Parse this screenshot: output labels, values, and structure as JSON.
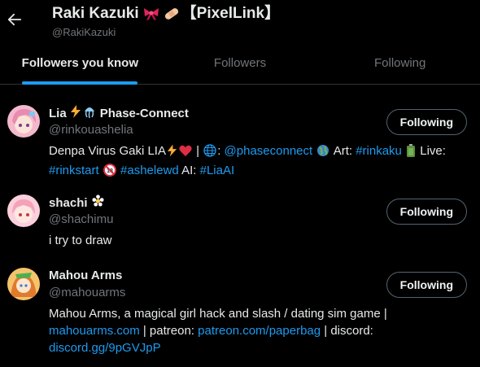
{
  "header": {
    "name": "Raki Kazuki",
    "name_suffix": "【PixelLink】",
    "handle": "@RakiKazuki"
  },
  "tabs": [
    {
      "label": "Followers you know",
      "active": true
    },
    {
      "label": "Followers",
      "active": false
    },
    {
      "label": "Following",
      "active": false
    }
  ],
  "colors": {
    "accent": "#1d9bf0",
    "muted": "#71767b",
    "text": "#e7e9ea",
    "background": "#000000"
  },
  "users": [
    {
      "name": "Lia",
      "name_suffix": "Phase-Connect",
      "handle": "@rinkouashelia",
      "button": "Following",
      "bio": {
        "t1": "Denpa Virus Gaki LIA",
        "t2": " | ",
        "t3": ": ",
        "l1": "@phaseconnect",
        "t4": " Art: ",
        "l2": "#rinkaku",
        "t5": " Live:",
        "l3": "#rinkstart",
        "t6": " ",
        "l4": "#ashelewd",
        "t7": " AI: ",
        "l5": "#LiaAI"
      }
    },
    {
      "name": "shachi",
      "handle": "@shachimu",
      "button": "Following",
      "bio": {
        "t1": "i try to draw"
      }
    },
    {
      "name": "Mahou Arms",
      "handle": "@mahouarms",
      "button": "Following",
      "bio": {
        "t1": "Mahou Arms, a magical girl hack and slash / dating sim game |",
        "l1": "mahouarms.com",
        "t2": " | patreon: ",
        "l2": "patreon.com/paperbag",
        "t3": " | discord:",
        "l3": "discord.gg/9pGVJpP"
      }
    }
  ],
  "icons": [
    "back-arrow-icon",
    "ribbon-emoji-icon",
    "bandage-emoji-icon",
    "lightning-emoji-icon",
    "jellyfish-emoji-icon",
    "heart-emoji-icon",
    "globe-emoji-icon",
    "battery-emoji-icon",
    "no-under-18-emoji-icon",
    "flower-emoji-icon"
  ]
}
